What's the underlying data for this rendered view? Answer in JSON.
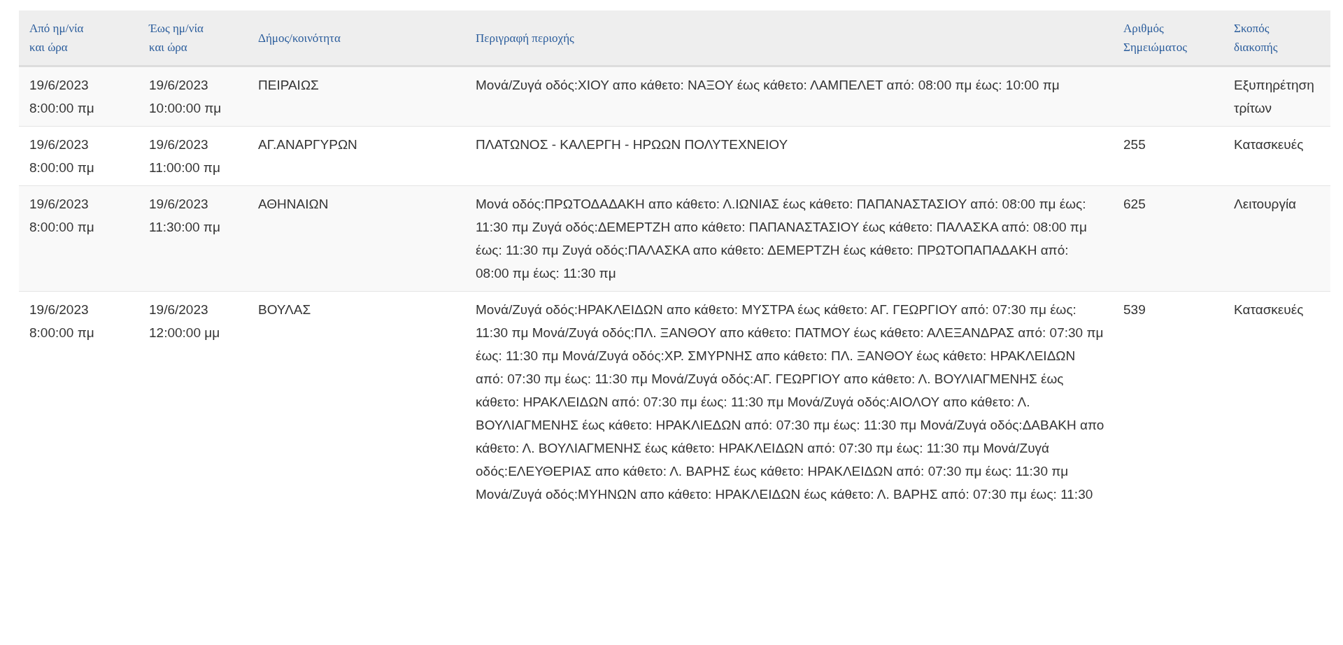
{
  "table": {
    "columns": [
      "Από ημ/νία και ώρα",
      "Έως ημ/νία και ώρα",
      "Δήμος/κοινότητα",
      "Περιγραφή περιοχής",
      "Αριθμός Σημειώματος",
      "Σκοπός διακοπής"
    ],
    "rows": [
      {
        "from": "19/6/2023 8:00:00 πμ",
        "to": "19/6/2023 10:00:00 πμ",
        "municipality": "ΠΕΙΡΑΙΩΣ",
        "description": "Μονά/Ζυγά οδός:ΧΙΟΥ απο κάθετο: ΝΑΞΟΥ έως κάθετο: ΛΑΜΠΕΛΕΤ από: 08:00 πμ έως: 10:00 πμ",
        "purpose": "Εξυπηρέτηση τρίτων"
      },
      {
        "from": "19/6/2023 8:00:00 πμ",
        "to": "19/6/2023 11:00:00 πμ",
        "municipality": "ΑΓ.ΑΝΑΡΓΥΡΩΝ",
        "description": "ΠΛΑΤΩΝΟΣ - ΚΑΛΕΡΓΗ - ΗΡΩΩΝ ΠΟΛΥΤΕΧΝΕΙΟΥ",
        "note": "255",
        "purpose": "Κατασκευές"
      },
      {
        "from": "19/6/2023 8:00:00 πμ",
        "to": "19/6/2023 11:30:00 πμ",
        "municipality": "ΑΘΗΝΑΙΩΝ",
        "description": "Μονά οδός:ΠΡΩΤΟΔΑΔΑΚΗ απο κάθετο: Λ.ΙΩΝΙΑΣ έως κάθετο: ΠΑΠΑΝΑΣΤΑΣΙΟΥ από: 08:00 πμ έως: 11:30 πμ Ζυγά οδός:ΔΕΜΕΡΤΖΗ απο κάθετο: ΠΑΠΑΝΑΣΤΑΣΙΟΥ έως κάθετο: ΠΑΛΑΣΚΑ από: 08:00 πμ έως: 11:30 πμ Ζυγά οδός:ΠΑΛΑΣΚΑ απο κάθετο: ΔΕΜΕΡΤΖΗ έως κάθετο: ΠΡΩΤΟΠΑΠΑΔΑΚΗ από: 08:00 πμ έως: 11:30 πμ",
        "note": "625",
        "purpose": "Λειτουργία"
      },
      {
        "from": "19/6/2023 8:00:00 πμ",
        "to": "19/6/2023 12:00:00 μμ",
        "municipality": "ΒΟΥΛΑΣ",
        "description": "Μονά/Ζυγά οδός:ΗΡΑΚΛΕΙΔΩΝ απο κάθετο: ΜΥΣΤΡΑ έως κάθετο: ΑΓ. ΓΕΩΡΓΙΟΥ από: 07:30 πμ έως: 11:30 πμ Μονά/Ζυγά οδός:ΠΛ. ΞΑΝΘΟΥ απο κάθετο: ΠΑΤΜΟΥ έως κάθετο: ΑΛΕΞΑΝΔΡΑΣ από: 07:30 πμ έως: 11:30 πμ Μονά/Ζυγά οδός:ΧΡ. ΣΜΥΡΝΗΣ απο κάθετο: ΠΛ. ΞΑΝΘΟΥ έως κάθετο: ΗΡΑΚΛΕΙΔΩΝ από: 07:30 πμ έως: 11:30 πμ Μονά/Ζυγά οδός:ΑΓ. ΓΕΩΡΓΙΟΥ απο κάθετο: Λ. ΒΟΥΛΙΑΓΜΕΝΗΣ έως κάθετο: ΗΡΑΚΛΕΙΔΩΝ από: 07:30 πμ έως: 11:30 πμ Μονά/Ζυγά οδός:ΑΙΟΛΟΥ απο κάθετο: Λ. ΒΟΥΛΙΑΓΜΕΝΗΣ έως κάθετο: ΗΡΑΚΛΙΕΔΩΝ από: 07:30 πμ έως: 11:30 πμ Μονά/Ζυγά οδός:ΔΑΒΑΚΗ απο κάθετο: Λ. ΒΟΥΛΙΑΓΜΕΝΗΣ έως κάθετο: ΗΡΑΚΛΕΙΔΩΝ από: 07:30 πμ έως: 11:30 πμ Μονά/Ζυγά οδός:ΕΛΕΥΘΕΡΙΑΣ απο κάθετο: Λ. ΒΑΡΗΣ έως κάθετο: ΗΡΑΚΛΕΙΔΩΝ από: 07:30 πμ έως: 11:30 πμ Μονά/Ζυγά οδός:ΜΥΗΝΩΝ απο κάθετο: ΗΡΑΚΛΕΙΔΩΝ έως κάθετο: Λ. ΒΑΡΗΣ από: 07:30 πμ έως: 11:30",
        "note": "539",
        "purpose": "Κατασκευές"
      }
    ]
  }
}
